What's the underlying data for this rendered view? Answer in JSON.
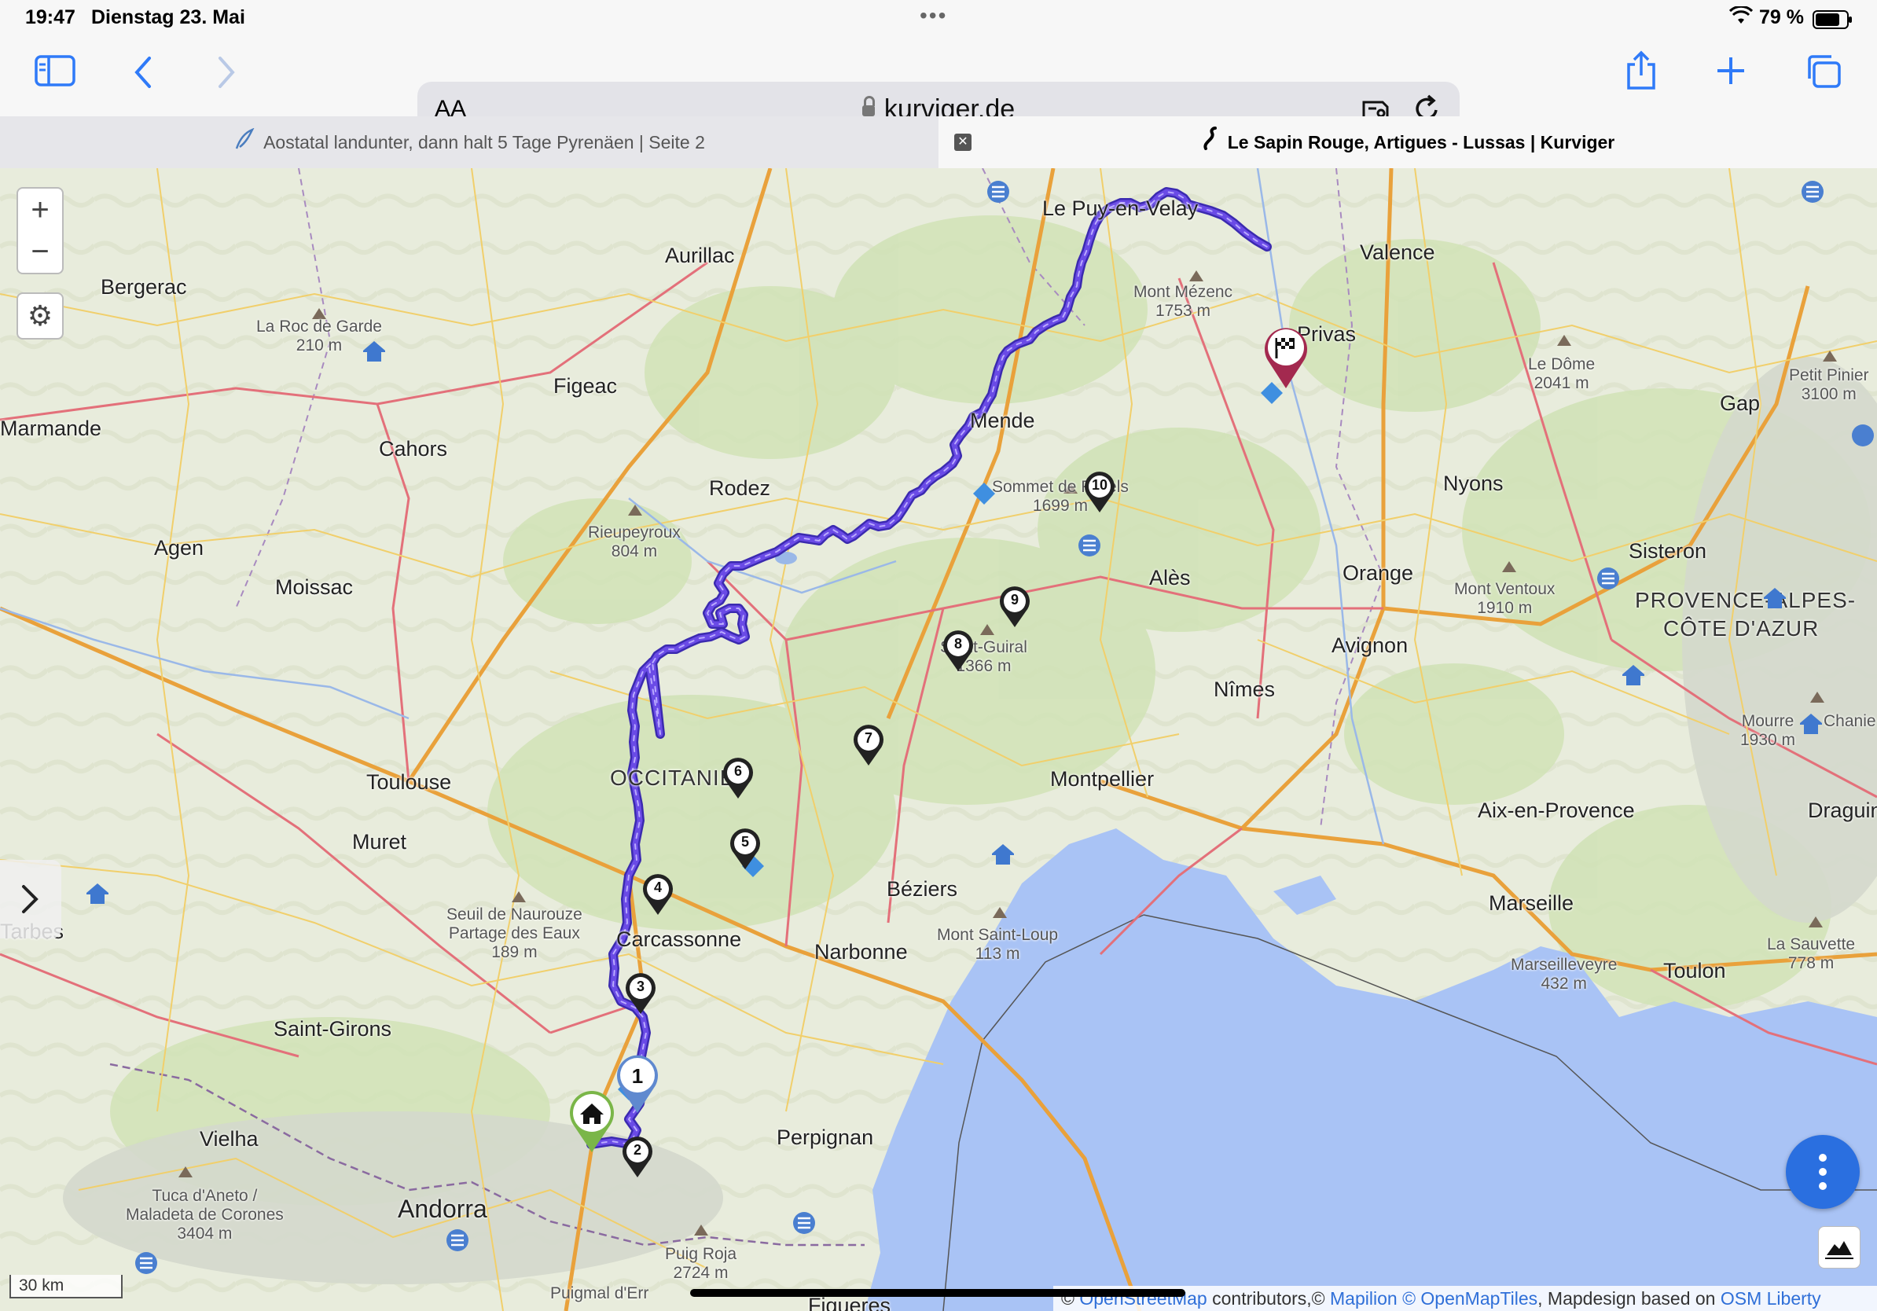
{
  "status_bar": {
    "time": "19:47",
    "date": "Dienstag 23. Mai",
    "battery": "79 %"
  },
  "browser": {
    "url_text_size": "AA",
    "domain": "kurviger.de",
    "tabs": [
      {
        "label": "Aostatal landunter, dann halt 5 Tage Pyrenäen | Seite 2"
      },
      {
        "label": "Le Sapin Rouge, Artigues - Lussas | Kurviger",
        "active": true
      }
    ]
  },
  "map": {
    "places": [
      {
        "name": "Le Puy-en-Velay"
      },
      {
        "name": "Valence"
      },
      {
        "name": "Bergerac"
      },
      {
        "name": "Aurillac"
      },
      {
        "name": "Mont Mézenc",
        "elev": "1753 m"
      },
      {
        "name": "La Roc de Garde",
        "elev": "210 m"
      },
      {
        "name": "Privas"
      },
      {
        "name": "Le Dôme",
        "elev": "2041 m"
      },
      {
        "name": "Petit Pinier",
        "elev": "3100 m"
      },
      {
        "name": "Gap"
      },
      {
        "name": "Figeac"
      },
      {
        "name": "Mende"
      },
      {
        "name": "Marmande"
      },
      {
        "name": "Cahors"
      },
      {
        "name": "Sommet de Finiels",
        "elev": "1699 m"
      },
      {
        "name": "Nyons"
      },
      {
        "name": "Rodez"
      },
      {
        "name": "Rieupeyroux",
        "elev": "804 m"
      },
      {
        "name": "Agen"
      },
      {
        "name": "Sisteron"
      },
      {
        "name": "Moissac"
      },
      {
        "name": "Alès"
      },
      {
        "name": "Orange"
      },
      {
        "name": "Mont Ventoux",
        "elev": "1910 m"
      },
      {
        "name": "PROVENCE-ALPES-"
      },
      {
        "name": "CÔTE D'AZUR"
      },
      {
        "name": "Saint-Guiral",
        "elev": "1366 m"
      },
      {
        "name": "Avignon"
      },
      {
        "name": "Nîmes"
      },
      {
        "name": "Mourre",
        "elev": "1930 m"
      },
      {
        "name": "Chanie"
      },
      {
        "name": "OCCITANIE"
      },
      {
        "name": "Toulouse"
      },
      {
        "name": "Montpellier"
      },
      {
        "name": "Aix-en-Provence"
      },
      {
        "name": "Draguin"
      },
      {
        "name": "Muret"
      },
      {
        "name": "Béziers"
      },
      {
        "name": "Seuil de Naurouze"
      },
      {
        "name": "Partage des Eaux",
        "elev": "189 m"
      },
      {
        "name": "Marseille"
      },
      {
        "name": "Carcassonne"
      },
      {
        "name": "Tarbes"
      },
      {
        "name": "Narbonne"
      },
      {
        "name": "Mont Saint-Loup",
        "elev": "113 m"
      },
      {
        "name": "Toulon"
      },
      {
        "name": "La Sauvette",
        "elev": "778 m"
      },
      {
        "name": "Marseilleveyre",
        "elev": "432 m"
      },
      {
        "name": "Saint-Girons"
      },
      {
        "name": "Vielha"
      },
      {
        "name": "Perpignan"
      },
      {
        "name": "Tuca d'Aneto /"
      },
      {
        "name": "Maladeta de Corones",
        "elev": "3404 m"
      },
      {
        "name": "Andorra"
      },
      {
        "name": "Puig Roja",
        "elev": "2724 m"
      },
      {
        "name": "Puigmal d'Err"
      },
      {
        "name": "Figueres"
      }
    ],
    "waypoints": [
      "1",
      "2",
      "3",
      "4",
      "5",
      "6",
      "7",
      "8",
      "9",
      "10"
    ],
    "scale": "30 km",
    "attribution": {
      "prefix": "© ",
      "osm": "OpenStreetMap",
      "mid": " contributors,© ",
      "mapilion": "Mapilion",
      "sep": " ",
      "omt": "© OpenMapTiles",
      "design": ", Mapdesign based on ",
      "liberty": "OSM Liberty"
    },
    "colors": {
      "route": "#5b35d6",
      "sea": "#a9c3f5",
      "fab": "#2a6fe0",
      "start": "#7ab648",
      "finish": "#a3294f"
    }
  },
  "controls": {
    "zoom_in": "+",
    "zoom_out": "−",
    "settings": "⚙"
  }
}
